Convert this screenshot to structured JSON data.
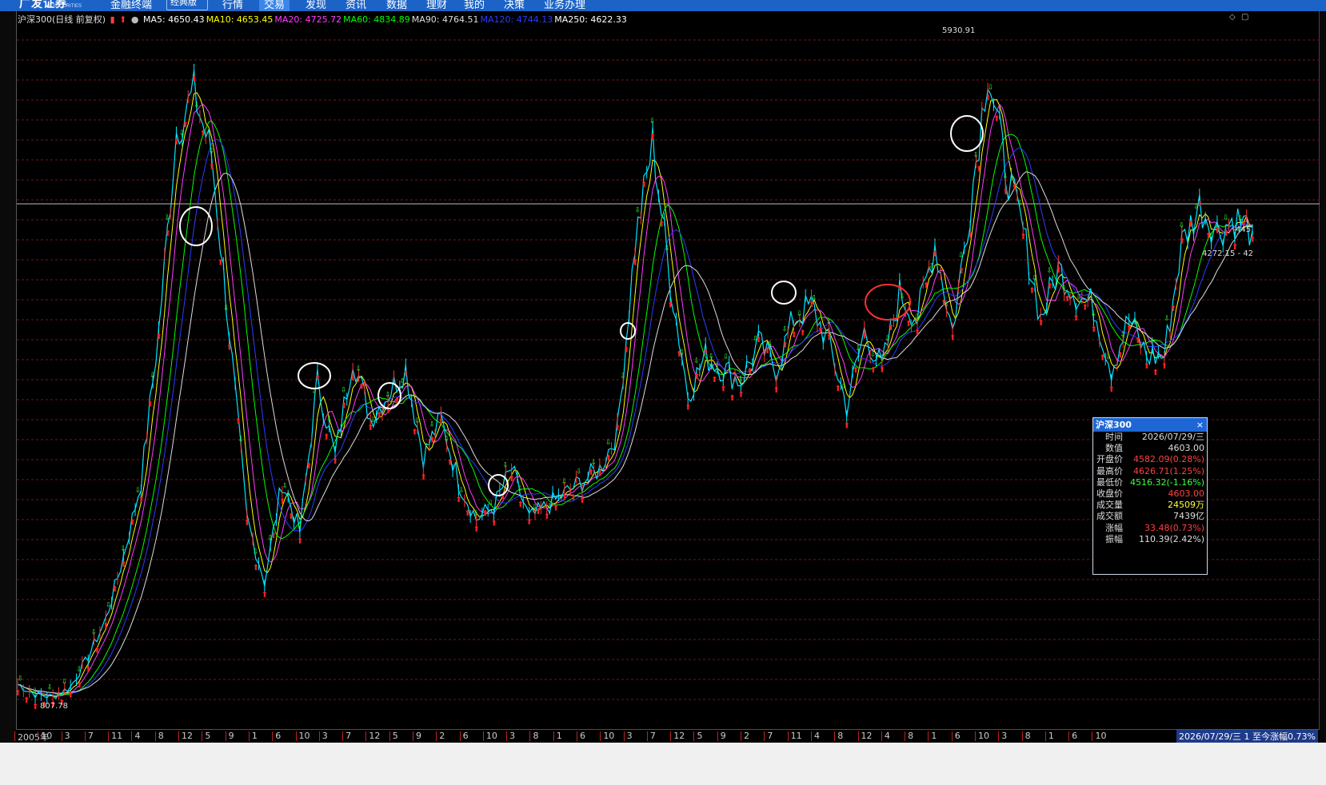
{
  "app": {
    "logo": "广发证券",
    "logo_sub": "GF SECURITIES",
    "title": "金融终端",
    "edition": "经典版 ˅",
    "menu": [
      "行情",
      "交易",
      "发现",
      "资讯",
      "数据",
      "理财",
      "我的",
      "决策",
      "业务办理"
    ],
    "active_menu": "交易"
  },
  "chart_header": {
    "symbol": "沪深300(日线 前复权)",
    "mas": [
      {
        "label": "MA5: 4650.43",
        "color": "#ffffff"
      },
      {
        "label": "MA10: 4653.45",
        "color": "#ffff00"
      },
      {
        "label": "MA20: 4725.72",
        "color": "#ff3cff"
      },
      {
        "label": "MA60: 4834.89",
        "color": "#00ff00"
      },
      {
        "label": "MA90: 4764.51",
        "color": "#dddddd"
      },
      {
        "label": "MA120: 4744.13",
        "color": "#2a3cff"
      },
      {
        "label": "MA250: 4622.33",
        "color": "#ffffff"
      }
    ]
  },
  "price_labels": {
    "high": "5930.91",
    "low": "807.78",
    "right_1": "445",
    "right_2": "4272.15 - 42"
  },
  "info_panel": {
    "title": "沪深300",
    "close_icon": "×",
    "rows": [
      {
        "label": "时间",
        "value": "2026/07/29/三",
        "color": "#dddddd"
      },
      {
        "label": "数值",
        "value": "4603.00",
        "color": "#dddddd"
      },
      {
        "label": "开盘价",
        "value": "4582.09(0.28%)",
        "color": "#ff4040"
      },
      {
        "label": "最高价",
        "value": "4626.71(1.25%)",
        "color": "#ff4040"
      },
      {
        "label": "最低价",
        "value": "4516.32(-1.16%)",
        "color": "#40ff40"
      },
      {
        "label": "收盘价",
        "value": "4603.00",
        "color": "#ff4040"
      },
      {
        "label": "成交量",
        "value": "24509万",
        "color": "#ffff40"
      },
      {
        "label": "成交额",
        "value": "7439亿",
        "color": "#dddddd"
      },
      {
        "label": "涨幅",
        "value": "33.48(0.73%)",
        "color": "#ff4040"
      },
      {
        "label": "振幅",
        "value": "110.39(2.42%)",
        "color": "#dddddd"
      }
    ]
  },
  "x_axis": {
    "ticks": [
      "2005年",
      "10",
      "3",
      "7",
      "11",
      "4",
      "8",
      "12",
      "5",
      "9",
      "1",
      "6",
      "10",
      "3",
      "7",
      "12",
      "5",
      "9",
      "2",
      "6",
      "10",
      "3",
      "8",
      "1",
      "6",
      "10",
      "3",
      "7",
      "12",
      "5",
      "9",
      "2",
      "7",
      "11",
      "4",
      "8",
      "12",
      "4",
      "8",
      "1",
      "6",
      "10",
      "3",
      "8",
      "1",
      "6",
      "10"
    ],
    "range_label": "2026/07/29/三 1 至今涨幅0.73%"
  },
  "chart_data": {
    "type": "line",
    "series": [
      {
        "name": "沪深300",
        "values": [
          980,
          900,
          880,
          960,
          1200,
          1500,
          2000,
          2600,
          3800,
          5400,
          5700,
          5200,
          3800,
          2300,
          1800,
          2600,
          2200,
          3400,
          2800,
          3600,
          3100,
          3300,
          3500,
          2800,
          3100,
          2600,
          2300,
          2400,
          2700,
          2300,
          2400,
          2500,
          2600,
          2700,
          3000,
          4500,
          5300,
          4200,
          3300,
          3600,
          3500,
          3400,
          3700,
          3500,
          3900,
          4000,
          3700,
          3200,
          3800,
          3500,
          4100,
          3900,
          4500,
          3800,
          4800,
          5900,
          5100,
          4600,
          3900,
          4300,
          4100,
          4000,
          3500,
          3900,
          3600,
          3600,
          4500,
          4800,
          4600,
          4700,
          4603
        ]
      }
    ],
    "ylim": [
      700,
      6200
    ],
    "annotations": [
      "5930.91",
      "807.78"
    ]
  }
}
